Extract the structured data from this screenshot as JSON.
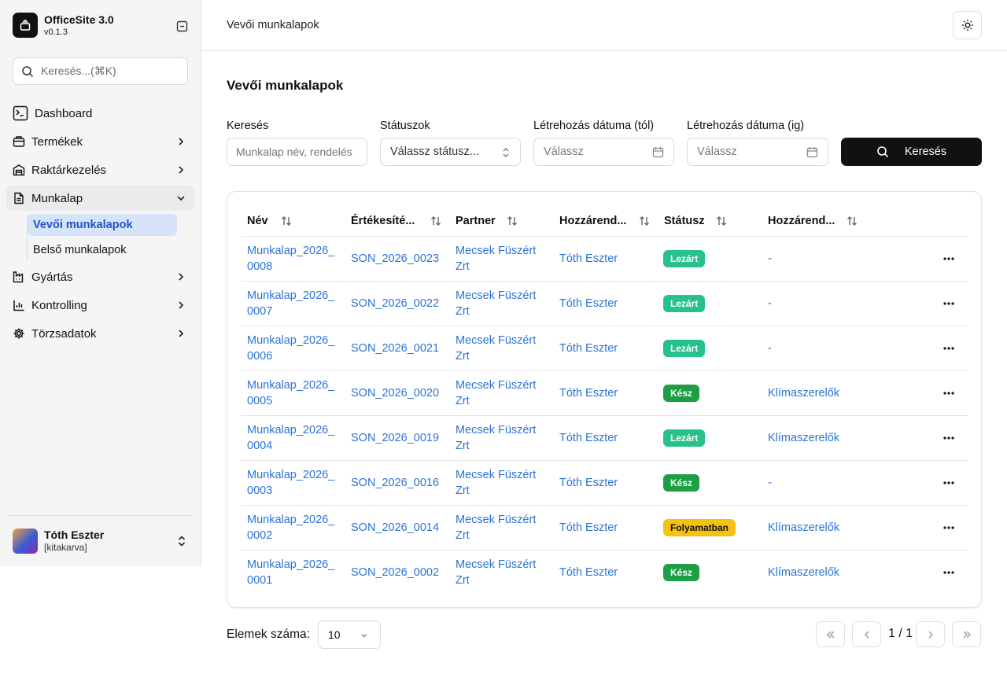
{
  "app": {
    "name": "OfficeSite 3.0",
    "version": "v0.1.3"
  },
  "sidebar": {
    "search_placeholder": "Keresés...(⌘K)",
    "items": [
      {
        "label": "Dashboard",
        "icon": "terminal-icon"
      },
      {
        "label": "Termékek",
        "icon": "package-icon"
      },
      {
        "label": "Raktárkezelés",
        "icon": "warehouse-icon"
      },
      {
        "label": "Munkalap",
        "icon": "file-text-icon"
      },
      {
        "label": "Gyártás",
        "icon": "factory-icon"
      },
      {
        "label": "Kontrolling",
        "icon": "bar-chart-icon"
      },
      {
        "label": "Törzsadatok",
        "icon": "gear-icon"
      }
    ],
    "sub_items": [
      {
        "label": "Vevői munkalapok",
        "active": true
      },
      {
        "label": "Belső munkalapok",
        "active": false
      }
    ],
    "user": {
      "name": "Tóth Eszter",
      "role": "[kitakarva]"
    }
  },
  "header": {
    "breadcrumb": "Vevői munkalapok"
  },
  "main": {
    "title": "Vevői munkalapok",
    "filters": {
      "search_label": "Keresés",
      "search_placeholder": "Munkalap név, rendelés",
      "status_label": "Státuszok",
      "status_placeholder": "Válassz státusz...",
      "date_from_label": "Létrehozás dátuma (tól)",
      "date_from_placeholder": "Válassz",
      "date_to_label": "Létrehozás dátuma (ig)",
      "date_to_placeholder": "Válassz",
      "search_button": "Keresés"
    },
    "table": {
      "columns": [
        "Név",
        "Értékesíté...",
        "Partner",
        "Hozzárend...",
        "Státusz",
        "Hozzárend..."
      ],
      "rows": [
        {
          "name": "Munkalap_2026_0008",
          "sale": "SON_2026_0023",
          "partner": "Mecsek Füszért Zrt",
          "assignee": "Tóth Eszter",
          "status": "Lezárt",
          "group": "-"
        },
        {
          "name": "Munkalap_2026_0007",
          "sale": "SON_2026_0022",
          "partner": "Mecsek Füszért Zrt",
          "assignee": "Tóth Eszter",
          "status": "Lezárt",
          "group": "-"
        },
        {
          "name": "Munkalap_2026_0006",
          "sale": "SON_2026_0021",
          "partner": "Mecsek Füszért Zrt",
          "assignee": "Tóth Eszter",
          "status": "Lezárt",
          "group": "-"
        },
        {
          "name": "Munkalap_2026_0005",
          "sale": "SON_2026_0020",
          "partner": "Mecsek Füszért Zrt",
          "assignee": "Tóth Eszter",
          "status": "Kész",
          "group": "Klímaszerelők"
        },
        {
          "name": "Munkalap_2026_0004",
          "sale": "SON_2026_0019",
          "partner": "Mecsek Füszért Zrt",
          "assignee": "Tóth Eszter",
          "status": "Lezárt",
          "group": "Klímaszerelők"
        },
        {
          "name": "Munkalap_2026_0003",
          "sale": "SON_2026_0016",
          "partner": "Mecsek Füszért Zrt",
          "assignee": "Tóth Eszter",
          "status": "Kész",
          "group": "-"
        },
        {
          "name": "Munkalap_2026_0002",
          "sale": "SON_2026_0014",
          "partner": "Mecsek Füszért Zrt",
          "assignee": "Tóth Eszter",
          "status": "Folyamatban",
          "group": "Klímaszerelők"
        },
        {
          "name": "Munkalap_2026_0001",
          "sale": "SON_2026_0002",
          "partner": "Mecsek Füszért Zrt",
          "assignee": "Tóth Eszter",
          "status": "Kész",
          "group": "Klímaszerelők"
        }
      ]
    },
    "status_colors": {
      "Lezárt": "#26c28a",
      "Kész": "#1e9e45",
      "Folyamatban": "#f5c211"
    },
    "link_color": "#2b73d8",
    "pagination": {
      "page_size_label": "Elemek száma:",
      "page_size": "10",
      "page_text": "1 / 1"
    }
  }
}
